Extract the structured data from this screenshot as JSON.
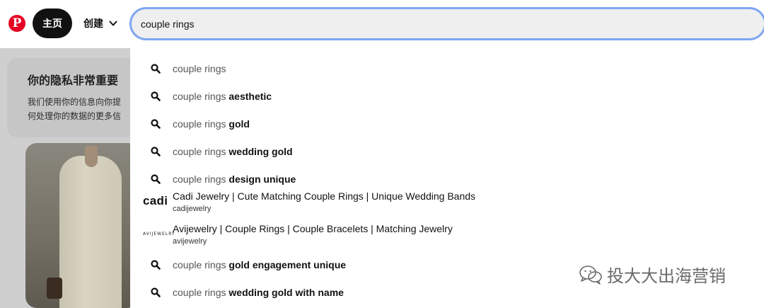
{
  "header": {
    "logo_letter": "P",
    "home_label": "主页",
    "create_label": "创建",
    "search_value": "couple rings"
  },
  "background": {
    "privacy_title": "你的隐私非常重要",
    "privacy_line1": "我们使用你的信息向你提",
    "privacy_line2": "何处理你的数据的更多信"
  },
  "suggestions": [
    {
      "prefix": "couple rings",
      "bold": ""
    },
    {
      "prefix": "couple rings",
      "bold": "aesthetic"
    },
    {
      "prefix": "couple rings",
      "bold": "gold"
    },
    {
      "prefix": "couple rings",
      "bold": "wedding gold"
    },
    {
      "prefix": "couple rings",
      "bold": "design unique"
    }
  ],
  "profiles": [
    {
      "logo_text": "cadi",
      "title": "Cadi Jewelry | Cute Matching Couple Rings | Unique Wedding Bands",
      "username": "cadijewelry"
    },
    {
      "logo_text": "AVIJEWELRY",
      "title": "Avijewelry | Couple Rings | Couple Bracelets | Matching Jewelry",
      "username": "avijewelry"
    }
  ],
  "suggestions_more": [
    {
      "prefix": "couple rings",
      "bold": "gold engagement unique"
    },
    {
      "prefix": "couple rings",
      "bold": "wedding gold with name"
    }
  ],
  "watermark": {
    "text": "投大大出海营销",
    "icon": "wechat-icon"
  },
  "colors": {
    "brand": "#e60023",
    "focus_ring": "#7fa6f2"
  },
  "icons": {
    "search": "search-icon",
    "chevron": "chevron-down-icon",
    "logo": "pinterest-logo-icon"
  }
}
